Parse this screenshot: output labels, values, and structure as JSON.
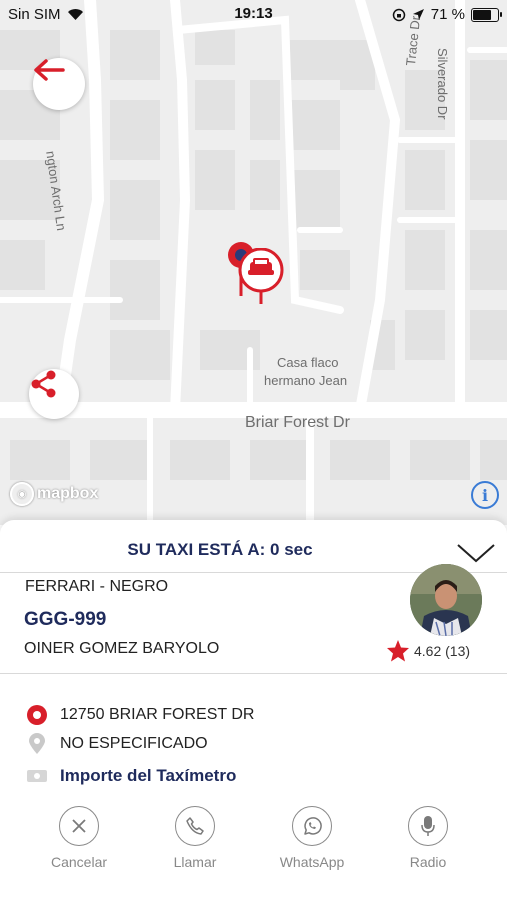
{
  "status_bar": {
    "carrier": "Sin SIM",
    "time": "19:13",
    "battery": "71 %",
    "battery_level": 0.71
  },
  "map": {
    "streets": [
      "ngton Arch Ln",
      "Trace Dr",
      "Silverado Dr",
      "Briar Forest Dr"
    ],
    "poi": [
      "Casa flaco",
      "hermano Jean"
    ],
    "attribution": "mapbox",
    "info_label": "i"
  },
  "sheet": {
    "eta": "SU TAXI ESTÁ A: 0 sec",
    "car": "FERRARI - NEGRO",
    "plate": "GGG-999",
    "driver": "OINER GOMEZ BARYOLO",
    "rating": "4.62 (13)",
    "pickup": "12750 BRIAR FOREST DR",
    "destination": "NO ESPECIFICADO",
    "payment": "Importe del Taxímetro"
  },
  "actions": [
    {
      "label": "Cancelar",
      "icon": "close-icon"
    },
    {
      "label": "Llamar",
      "icon": "phone-icon"
    },
    {
      "label": "WhatsApp",
      "icon": "whatsapp-icon"
    },
    {
      "label": "Radio",
      "icon": "microphone-icon"
    }
  ],
  "colors": {
    "brand_red": "#d81f2a",
    "navy": "#1f2b5c",
    "map_bg": "#eeeeee"
  }
}
